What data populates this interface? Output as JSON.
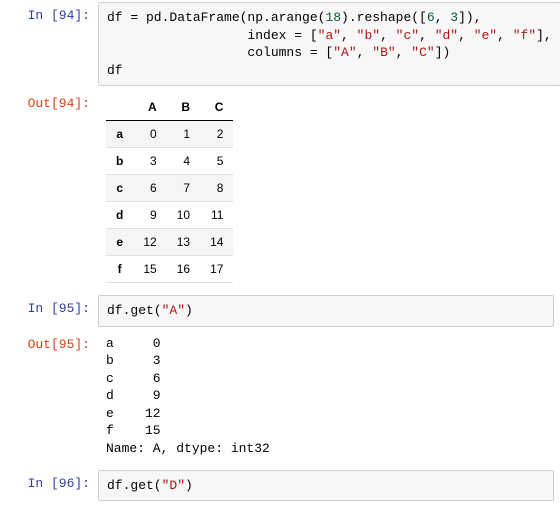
{
  "cells": {
    "in94": {
      "label": "In [94]:"
    },
    "out94": {
      "label": "Out[94]:"
    },
    "in95": {
      "label": "In [95]:"
    },
    "out95": {
      "label": "Out[95]:"
    },
    "in96": {
      "label": "In [96]:"
    }
  },
  "code94": {
    "line1_pre": "df = pd.DataFrame(np.arange(",
    "line1_num": "18",
    "line1_post": ").reshape([",
    "line1_n2": "6",
    "line1_c": ", ",
    "line1_n3": "3",
    "line1_end": "]),",
    "line2_lead": "                  index = [",
    "line2_a": "\"a\"",
    "line2_s1": ", ",
    "line2_b": "\"b\"",
    "line2_s2": ", ",
    "line2_c": "\"c\"",
    "line2_s3": ", ",
    "line2_d": "\"d\"",
    "line2_s4": ", ",
    "line2_e": "\"e\"",
    "line2_s5": ", ",
    "line2_f": "\"f\"",
    "line2_end": "],",
    "line3_lead": "                  columns = [",
    "line3_A": "\"A\"",
    "line3_s1": ", ",
    "line3_B": "\"B\"",
    "line3_s2": ", ",
    "line3_C": "\"C\"",
    "line3_end": "])",
    "line4": "df"
  },
  "df94": {
    "cols": [
      "A",
      "B",
      "C"
    ],
    "rows": [
      {
        "idx": "a",
        "v": [
          "0",
          "1",
          "2"
        ]
      },
      {
        "idx": "b",
        "v": [
          "3",
          "4",
          "5"
        ]
      },
      {
        "idx": "c",
        "v": [
          "6",
          "7",
          "8"
        ]
      },
      {
        "idx": "d",
        "v": [
          "9",
          "10",
          "11"
        ]
      },
      {
        "idx": "e",
        "v": [
          "12",
          "13",
          "14"
        ]
      },
      {
        "idx": "f",
        "v": [
          "15",
          "16",
          "17"
        ]
      }
    ]
  },
  "code95": {
    "pre": "df.get(",
    "arg": "\"A\"",
    "post": ")"
  },
  "out95_text": "a     0\nb     3\nc     6\nd     9\ne    12\nf    15\nName: A, dtype: int32",
  "out95_series": {
    "pairs": [
      {
        "idx": "a",
        "v": 0
      },
      {
        "idx": "b",
        "v": 3
      },
      {
        "idx": "c",
        "v": 6
      },
      {
        "idx": "d",
        "v": 9
      },
      {
        "idx": "e",
        "v": 12
      },
      {
        "idx": "f",
        "v": 15
      }
    ],
    "footer": "Name: A, dtype: int32"
  },
  "code96": {
    "pre": "df.get(",
    "arg": "\"D\"",
    "post": ")"
  }
}
